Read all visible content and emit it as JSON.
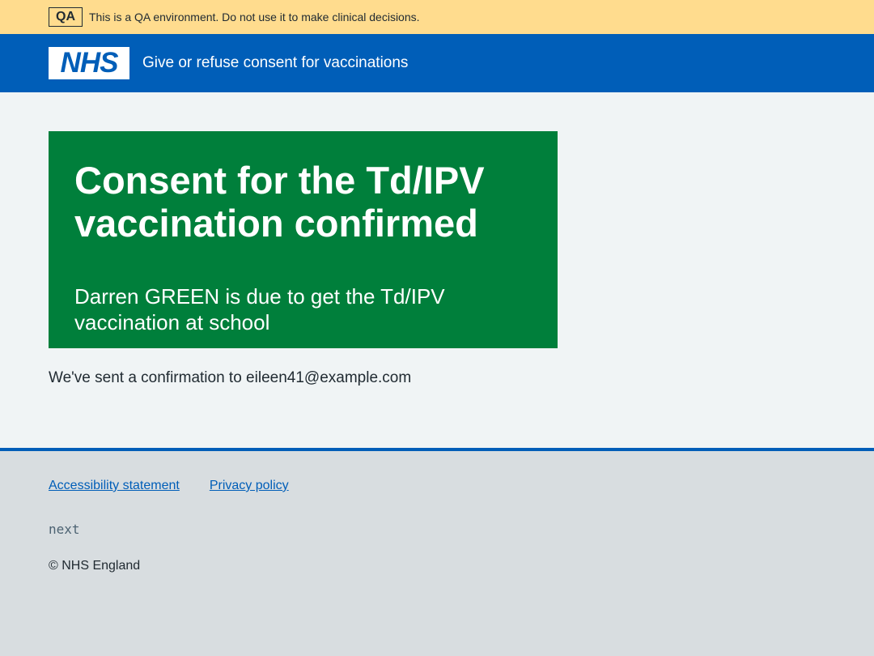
{
  "env_banner": {
    "tag": "QA",
    "text": "This is a QA environment. Do not use it to make clinical decisions."
  },
  "header": {
    "logo_text": "NHS",
    "service_name": "Give or refuse consent for vaccinations"
  },
  "panel": {
    "title": "Consent for the Td/IPV vaccination confirmed",
    "body": "Darren GREEN is due to get the Td/IPV vaccination at school"
  },
  "confirmation": "We've sent a confirmation to eileen41@example.com",
  "footer": {
    "links": [
      {
        "label": "Accessibility statement"
      },
      {
        "label": "Privacy policy"
      }
    ],
    "version": "next",
    "copyright": "© NHS England"
  },
  "colors": {
    "banner": "#ffdc8e",
    "header": "#005eb8",
    "panel": "#007f3b",
    "main_bg": "#f0f4f5",
    "footer_bg": "#d8dde0",
    "link": "#005eb8"
  }
}
